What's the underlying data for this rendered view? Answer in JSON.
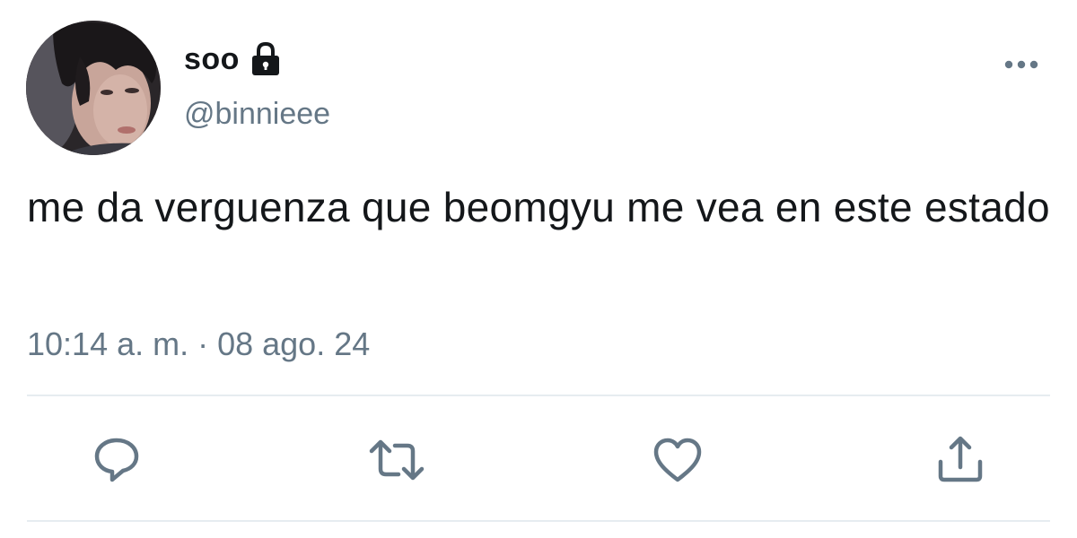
{
  "author": {
    "display_name": "soo",
    "handle": "@binnieee",
    "protected_icon": "lock-icon",
    "avatar": "profile-photo"
  },
  "tweet": {
    "text": "me da verguenza que beomgyu me vea en este estado",
    "timestamp": "10:14 a. m. · 08 ago. 24"
  },
  "actions": [
    {
      "name": "reply",
      "icon": "reply-icon"
    },
    {
      "name": "retweet",
      "icon": "retweet-icon"
    },
    {
      "name": "like",
      "icon": "heart-icon"
    },
    {
      "name": "share",
      "icon": "share-icon"
    }
  ],
  "menu_icon": "more-options-icon",
  "colors": {
    "text": "#14171a",
    "secondary": "#657786",
    "divider": "#e6ecf0"
  }
}
